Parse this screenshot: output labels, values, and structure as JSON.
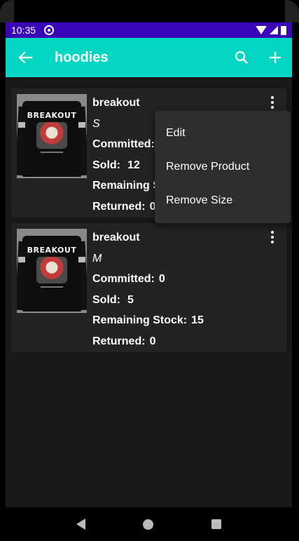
{
  "status_bar": {
    "time": "10:35",
    "sync_icon": "sync-icon",
    "wifi_icon": "wifi-icon",
    "signal_icon": "cellular-signal-icon",
    "battery_icon": "battery-icon"
  },
  "app_bar": {
    "title": "hoodies",
    "back_icon": "arrow-back-icon",
    "search_icon": "search-icon",
    "add_icon": "add-icon",
    "background": "#03d7c4"
  },
  "products": [
    {
      "name": "breakout",
      "size": "S",
      "committed_label": "Committed:",
      "committed_value": "",
      "sold_label": "Sold:",
      "sold_value": "12",
      "remaining_label": "Remaining S",
      "remaining_value": "",
      "returned_label": "Returned:",
      "returned_value": "0",
      "image_brand": "BREAKOUT"
    },
    {
      "name": "breakout",
      "size": "M",
      "committed_label": "Committed:",
      "committed_value": "0",
      "sold_label": "Sold:",
      "sold_value": "5",
      "remaining_label": "Remaining Stock:",
      "remaining_value": "15",
      "returned_label": "Returned:",
      "returned_value": "0",
      "image_brand": "BREAKOUT"
    }
  ],
  "menu": {
    "items": [
      "Edit",
      "Remove Product",
      "Remove Size"
    ]
  },
  "colors": {
    "status_bar": "#3a06b8",
    "accent": "#03d7c4",
    "card": "#232323",
    "background": "#181818"
  }
}
